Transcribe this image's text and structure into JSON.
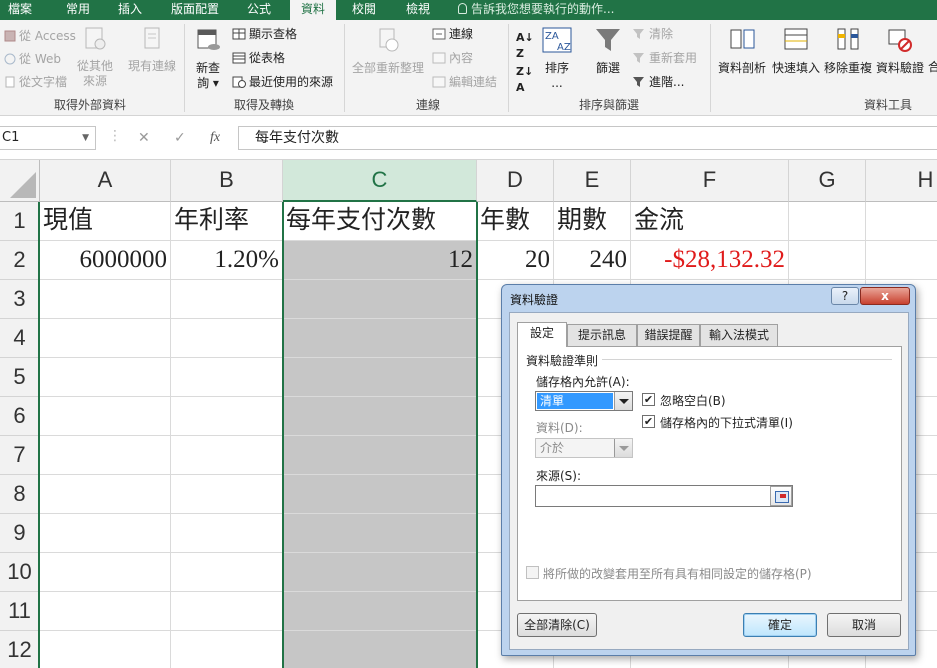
{
  "ribbon_tabs": [
    "檔案",
    "常用",
    "插入",
    "版面配置",
    "公式",
    "資料",
    "校閱",
    "檢視"
  ],
  "active_tab": "資料",
  "tell_me": "告訴我您想要執行的動作...",
  "groups": {
    "external": {
      "label": "取得外部資料",
      "access": "從 Access",
      "web": "從 Web",
      "text": "從文字檔",
      "other": "從其他",
      "other2": "來源",
      "existing": "現有連線"
    },
    "transform": {
      "label": "取得及轉換",
      "new_query": "新查",
      "new_query2": "詢",
      "show_queries": "顯示查格",
      "from_table": "從表格",
      "recent": "最近使用的來源"
    },
    "connections": {
      "label": "連線",
      "refresh_all": "全部重新整理",
      "connections": "連線",
      "properties": "內容",
      "edit_links": "編輯連結"
    },
    "sort_filter": {
      "label": "排序與篩選",
      "sort": "排序",
      "sort_more": "...",
      "filter": "篩選",
      "clear": "清除",
      "reapply": "重新套用",
      "advanced": "進階..."
    },
    "data_tools": {
      "label": "資料工具",
      "text_to_columns": "資料剖析",
      "flash_fill": "快速填入",
      "remove_duplicates": "移除重複",
      "data_validation": "資料驗證",
      "combine": "合"
    }
  },
  "formula_bar": {
    "name_box": "C1",
    "cancel": "✕",
    "enter": "✓",
    "fx": "fx",
    "content": "每年支付次數"
  },
  "columns": [
    "A",
    "B",
    "C",
    "D",
    "E",
    "F",
    "G",
    "H"
  ],
  "rows": [
    "1",
    "2",
    "3",
    "4",
    "5",
    "6",
    "7",
    "8",
    "9",
    "10",
    "11",
    "12"
  ],
  "cells": {
    "A1": "現值",
    "B1": "年利率",
    "C1": "每年支付次數",
    "D1": "年數",
    "E1": "期數",
    "F1": "金流",
    "A2": "6000000",
    "B2": "1.20%",
    "C2": "12",
    "D2": "20",
    "E2": "240",
    "F2": "-$28,132.32"
  },
  "dialog": {
    "title": "資料驗證",
    "help": "?",
    "close": "x",
    "tabs": [
      "設定",
      "提示訊息",
      "錯誤提醒",
      "輸入法模式"
    ],
    "criteria_heading": "資料驗證準則",
    "allow_label": "儲存格內允許(A):",
    "allow_value": "清單",
    "ignore_blank": "忽略空白(B)",
    "in_cell_dropdown": "儲存格內的下拉式清單(I)",
    "data_label": "資料(D):",
    "data_value": "介於",
    "source_label": "來源(S):",
    "source_value": "",
    "apply_all": "將所做的改變套用至所有具有相同設定的儲存格(P)",
    "clear_all": "全部清除(C)",
    "ok": "確定",
    "cancel": "取消"
  },
  "colors": {
    "excel_green": "#217346",
    "negative_red": "#e01b1b",
    "selection_fill": "#c6c6c6"
  }
}
